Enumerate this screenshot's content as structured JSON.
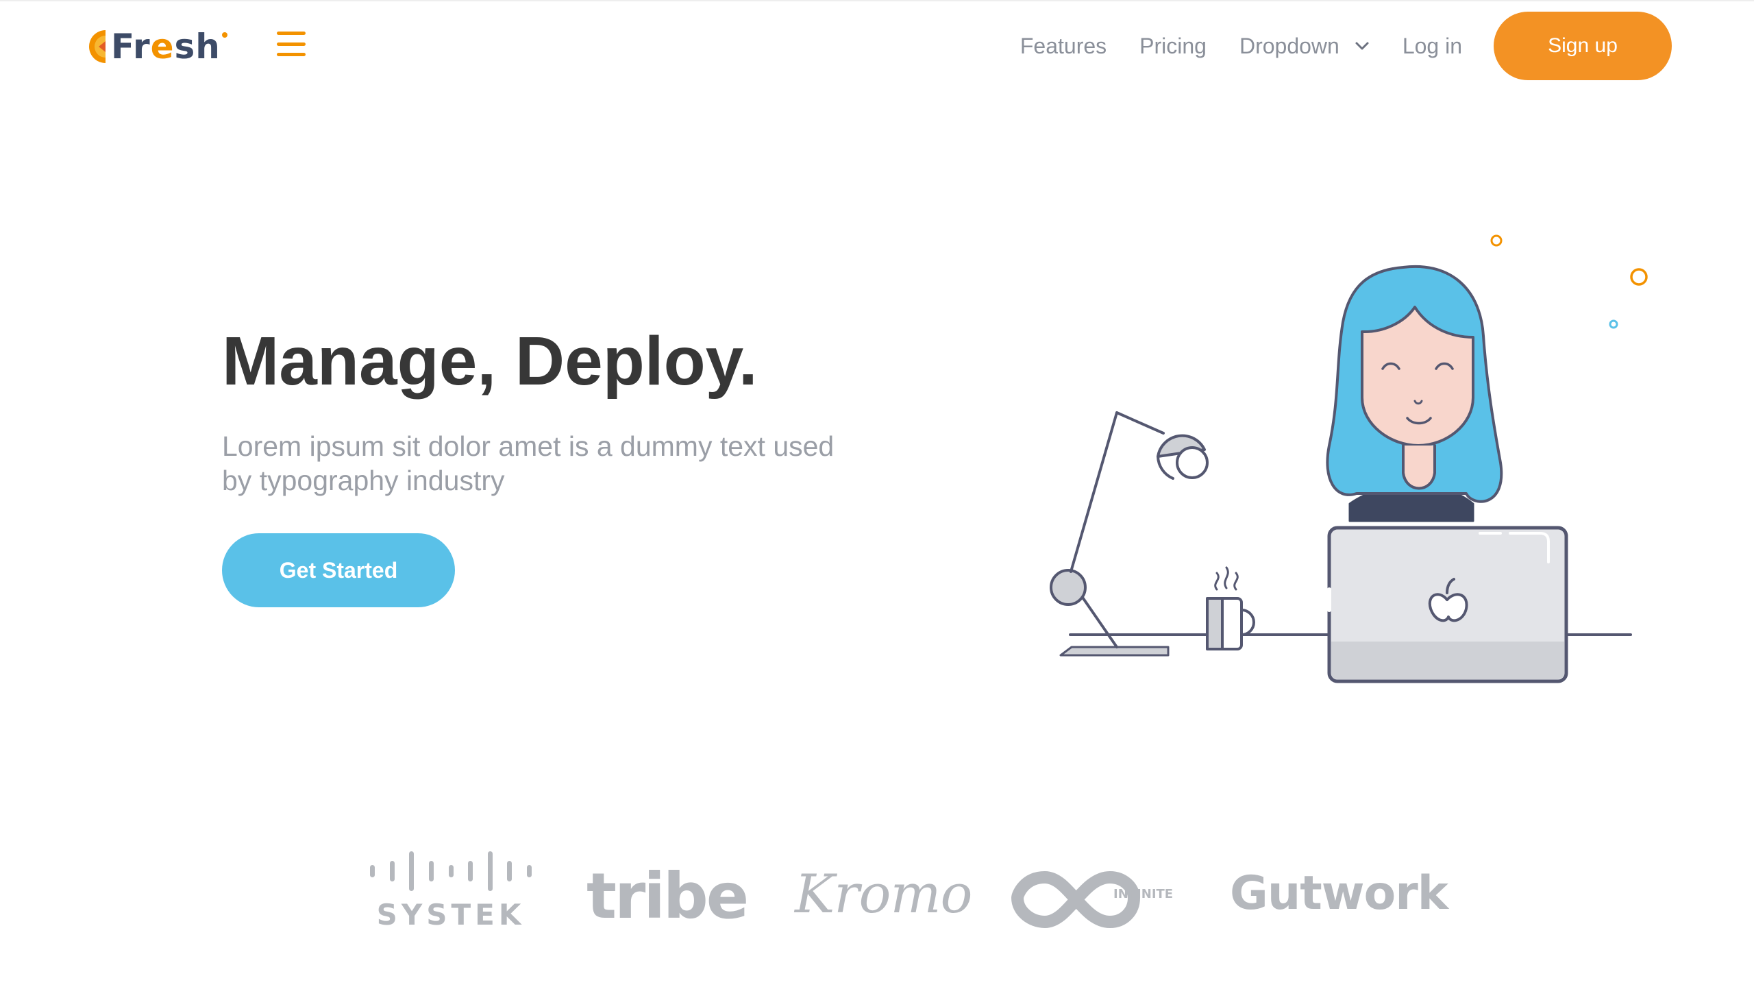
{
  "brand": {
    "name_dark": "Fr",
    "name_accent": "e",
    "name_tail": "sh"
  },
  "nav": {
    "links": [
      "Features",
      "Pricing",
      "Dropdown",
      "Log in"
    ],
    "signup_label": "Sign up"
  },
  "hero": {
    "title": "Manage, Deploy.",
    "subtitle_line1": "Lorem ipsum sit dolor amet is a dummy text used",
    "subtitle_line2": "by typography industry",
    "cta_label": "Get Started"
  },
  "clients": {
    "systek": "SYSTEK",
    "tribe": "tribe",
    "kromo": "Kromo",
    "infinite": "INFINITE",
    "gutwork": "Gutwork"
  },
  "colors": {
    "accent_orange": "#f39224",
    "primary_blue": "#5ac1e8",
    "heading": "#373737",
    "muted": "#9a9ea6",
    "logo_gray": "#b5b8bd"
  }
}
